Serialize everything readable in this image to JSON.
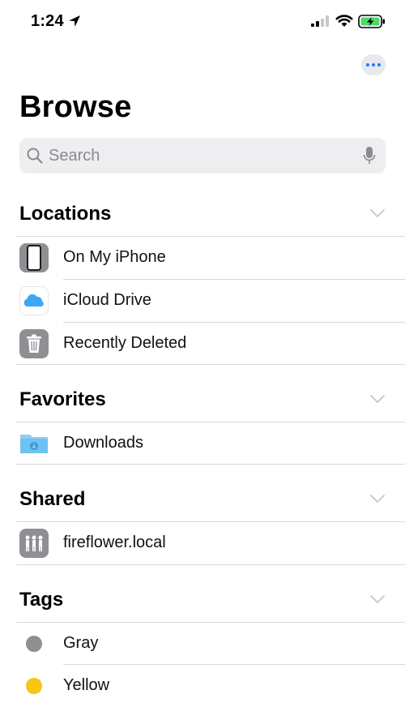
{
  "status": {
    "time": "1:24"
  },
  "page": {
    "title": "Browse"
  },
  "search": {
    "placeholder": "Search"
  },
  "sections": {
    "locations": {
      "title": "Locations",
      "items": [
        {
          "label": "On My iPhone",
          "icon": "iphone-icon"
        },
        {
          "label": "iCloud Drive",
          "icon": "icloud-icon"
        },
        {
          "label": "Recently Deleted",
          "icon": "trash-icon"
        }
      ]
    },
    "favorites": {
      "title": "Favorites",
      "items": [
        {
          "label": "Downloads",
          "icon": "downloads-folder-icon"
        }
      ]
    },
    "shared": {
      "title": "Shared",
      "items": [
        {
          "label": "fireflower.local",
          "icon": "shared-server-icon"
        }
      ]
    },
    "tags": {
      "title": "Tags",
      "items": [
        {
          "label": "Gray",
          "color": "#8e8e93"
        },
        {
          "label": "Yellow",
          "color": "#f7c514"
        }
      ]
    }
  },
  "colors": {
    "accent": "#1f7cf5",
    "battery": "#4cd964"
  }
}
